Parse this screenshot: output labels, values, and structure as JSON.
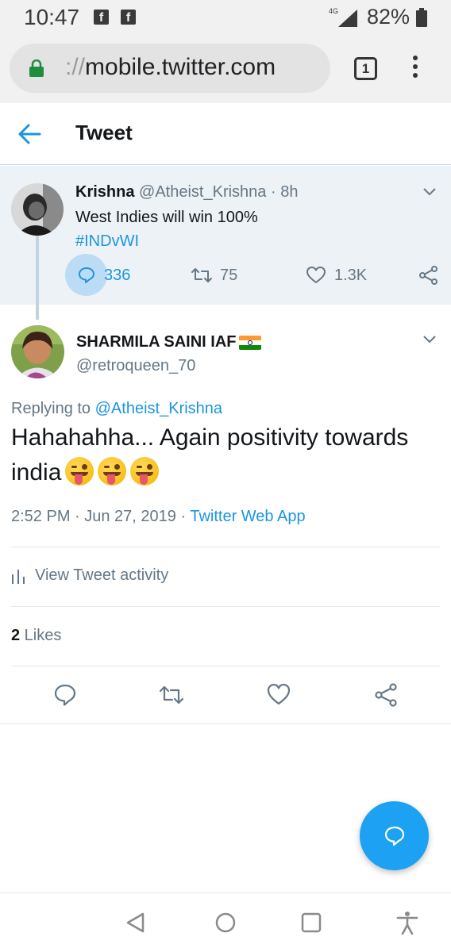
{
  "status_bar": {
    "time": "10:47",
    "notification_icons": [
      "facebook-icon",
      "facebook-icon"
    ],
    "network": "4G",
    "battery": "82%"
  },
  "browser": {
    "url_scheme": "://",
    "url_host": "mobile.twitter.com",
    "tab_count": "1"
  },
  "header": {
    "title": "Tweet"
  },
  "parent_tweet": {
    "name": "Krishna",
    "handle": "@Atheist_Krishna",
    "separator": " · ",
    "age": "8h",
    "text": "West Indies will win 100%",
    "hashtag": "#INDvWI",
    "replies": "336",
    "retweets": "75",
    "likes": "1.3K"
  },
  "main_tweet": {
    "name": "SHARMILA SAINI IAF",
    "handle": "@retroqueen_70",
    "replying_prefix": "Replying to ",
    "replying_to": "@Atheist_Krishna",
    "text": "Hahahahha... Again positivity towards india",
    "emoji_count": 3,
    "timestamp": "2:52 PM · Jun 27, 2019 · ",
    "source": "Twitter Web App",
    "activity_label": "View Tweet activity",
    "likes_count": "2",
    "likes_label": " Likes"
  },
  "colors": {
    "accent": "#1b95e0",
    "fab": "#1da1f2",
    "parent_bg": "#edf2f6",
    "muted_text": "#657786"
  }
}
